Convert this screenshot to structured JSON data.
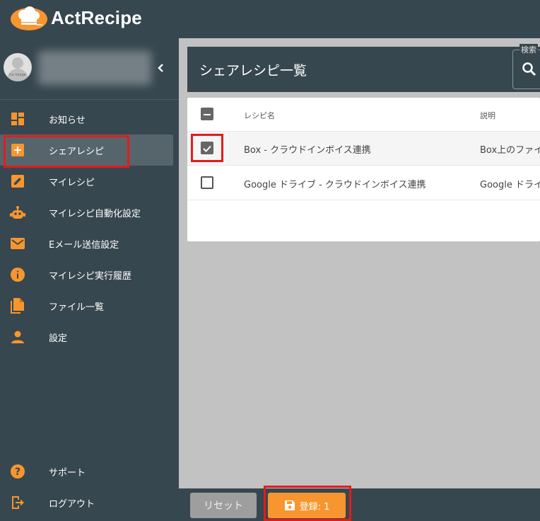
{
  "app": {
    "name": "ActRecipe"
  },
  "profile": {
    "avatar_text": "no image"
  },
  "sidebar": {
    "items": [
      {
        "label": "お知らせ",
        "icon": "dashboard-icon"
      },
      {
        "label": "シェアレシピ",
        "icon": "add-box-icon"
      },
      {
        "label": "マイレシピ",
        "icon": "edit-icon"
      },
      {
        "label": "マイレシピ自動化設定",
        "icon": "robot-icon"
      },
      {
        "label": "Eメール送信設定",
        "icon": "mail-icon"
      },
      {
        "label": "マイレシピ実行履歴",
        "icon": "info-icon"
      },
      {
        "label": "ファイル一覧",
        "icon": "file-copy-icon"
      },
      {
        "label": "設定",
        "icon": "person-icon"
      }
    ],
    "bottom_items": [
      {
        "label": "サポート",
        "icon": "help-icon"
      },
      {
        "label": "ログアウト",
        "icon": "logout-icon"
      }
    ]
  },
  "main": {
    "title": "シェアレシピ一覧",
    "search_label": "検索",
    "table": {
      "headers": {
        "name": "レシピ名",
        "description": "説明"
      },
      "rows": [
        {
          "name": "Box - クラウドインボイス連携",
          "description": "Box上のファイ",
          "checked": true
        },
        {
          "name": "Google ドライブ - クラウドインボイス連携",
          "description": "Google ドライ",
          "checked": false
        }
      ]
    }
  },
  "footer": {
    "reset_label": "リセット",
    "save_label": "登録: 1"
  },
  "colors": {
    "sidebar_bg": "#37474f",
    "accent": "#f7962e",
    "highlight": "#e31b1b",
    "content_bg": "#c2c2c2"
  }
}
